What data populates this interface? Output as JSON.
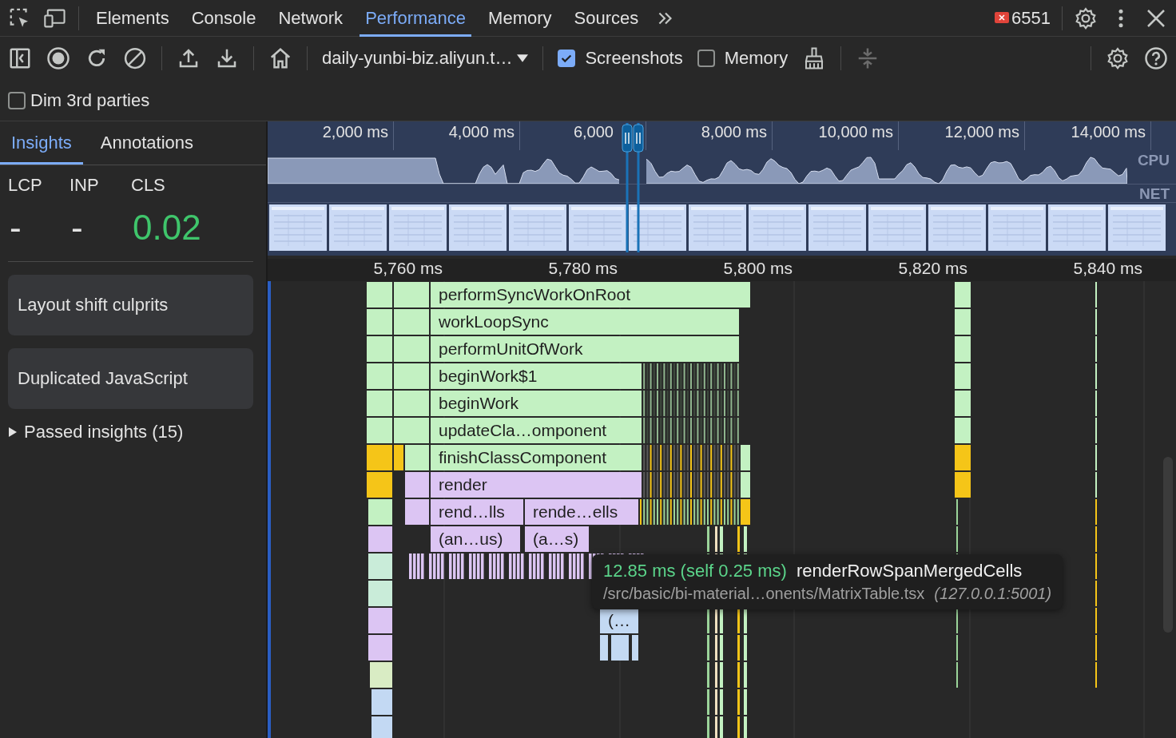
{
  "tabs": [
    {
      "label": "Elements",
      "selected": false
    },
    {
      "label": "Console",
      "selected": false
    },
    {
      "label": "Network",
      "selected": false
    },
    {
      "label": "Performance",
      "selected": true
    },
    {
      "label": "Memory",
      "selected": false
    },
    {
      "label": "Sources",
      "selected": false
    }
  ],
  "error_count": "6551",
  "toolbar": {
    "url": "daily-yunbi-biz.aliyun.t…",
    "screenshots": {
      "label": "Screenshots",
      "checked": true
    },
    "memory": {
      "label": "Memory",
      "checked": false
    }
  },
  "dim_3rd_parties": {
    "label": "Dim 3rd parties",
    "checked": false
  },
  "sidebar": {
    "tabs": [
      {
        "label": "Insights",
        "selected": true
      },
      {
        "label": "Annotations",
        "selected": false
      }
    ],
    "metrics": [
      {
        "name": "LCP",
        "value": "-",
        "color": "#e3e3e3"
      },
      {
        "name": "INP",
        "value": "-",
        "color": "#e3e3e3"
      },
      {
        "name": "CLS",
        "value": "0.02",
        "color": "#3fc56b"
      }
    ],
    "insights": [
      "Layout shift culprits",
      "Duplicated JavaScript"
    ],
    "passed": {
      "label": "Passed insights (15)",
      "expanded": false
    }
  },
  "overview": {
    "ticks": [
      "2,000 ms",
      "4,000 ms",
      "6,000",
      "8,000 ms",
      "10,000 ms",
      "12,000 ms",
      "14,000 ms"
    ],
    "cpu_label": "CPU",
    "net_label": "NET"
  },
  "ruler": {
    "ticks": [
      "5,760 ms",
      "5,780 ms",
      "5,800 ms",
      "5,820 ms",
      "5,840 ms"
    ]
  },
  "flame": {
    "entries": [
      {
        "label": "performSyncWorkOnRoot",
        "color": "#c3f1c2"
      },
      {
        "label": "workLoopSync",
        "color": "#c3f1c2"
      },
      {
        "label": "performUnitOfWork",
        "color": "#c3f1c2"
      },
      {
        "label": "beginWork$1",
        "color": "#c3f1c2"
      },
      {
        "label": "beginWork",
        "color": "#c3f1c2"
      },
      {
        "label": "updateCla…omponent",
        "color": "#c3f1c2"
      },
      {
        "label": "finishClassComponent",
        "color": "#c3f1c2"
      },
      {
        "label": "render",
        "color": "#dcc5f3"
      },
      {
        "label": "rend…lls",
        "color": "#dcc5f3"
      },
      {
        "label": "rende…ells",
        "color": "#dcc5f3"
      },
      {
        "label": "(an…us)",
        "color": "#dcc5f3"
      },
      {
        "label": "(a…s)",
        "color": "#dcc5f3"
      },
      {
        "label": "(…",
        "color": "#c3d9f3"
      }
    ]
  },
  "tooltip": {
    "duration": "12.85 ms (self 0.25 ms)",
    "name": "renderRowSpanMergedCells",
    "source": "/src/basic/bi-material…onents/MatrixTable.tsx",
    "origin": "(127.0.0.1:5001)"
  }
}
